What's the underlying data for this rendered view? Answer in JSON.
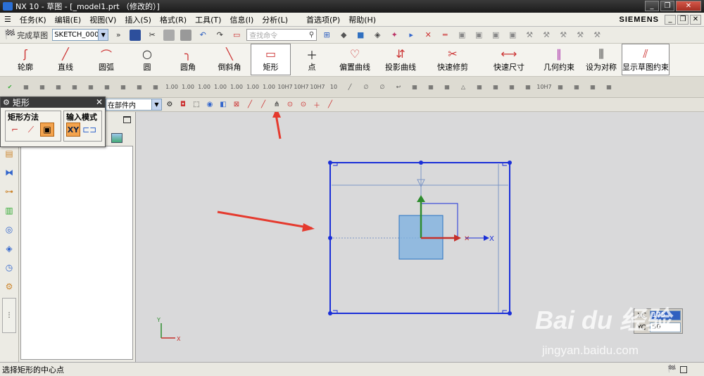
{
  "window": {
    "title": "NX 10 - 草图 - [_model1.prt （修改的）]",
    "brand": "SIEMENS",
    "min_label": "_",
    "restore_label": "❐",
    "close_label": "✕"
  },
  "menu": [
    "任务(K)",
    "编辑(E)",
    "视图(V)",
    "插入(S)",
    "格式(R)",
    "工具(T)",
    "信息(I)",
    "分析(L)",
    "首选项(P)",
    "帮助(H)"
  ],
  "toolbar": {
    "finish_sketch": "完成草图",
    "sketch_name": "SKETCH_000",
    "search_placeholder": "查找命令"
  },
  "ribbon": [
    {
      "label": "轮廓",
      "icon": "ʃ"
    },
    {
      "label": "直线",
      "icon": "╱"
    },
    {
      "label": "圆弧",
      "icon": "⌒"
    },
    {
      "label": "圆",
      "icon": "○"
    },
    {
      "label": "圆角",
      "icon": "╮"
    },
    {
      "label": "倒斜角",
      "icon": "╲"
    },
    {
      "label": "矩形",
      "icon": "▭"
    },
    {
      "label": "点",
      "icon": "＋"
    },
    {
      "label": "偏置曲线",
      "icon": "♡"
    },
    {
      "label": "投影曲线",
      "icon": "⇵"
    },
    {
      "label": "快速修剪",
      "icon": "✂"
    },
    {
      "label": "快速尺寸",
      "icon": "⟷"
    },
    {
      "label": "几何约束",
      "icon": "∥"
    },
    {
      "label": "设为对称",
      "icon": "⫼"
    },
    {
      "label": "显示草图约束",
      "icon": "⫽"
    }
  ],
  "filter": {
    "value": "在部件内"
  },
  "rect_dialog": {
    "title": "矩形",
    "method_label": "矩形方法",
    "input_mode_label": "输入模式",
    "xy_label": "XY"
  },
  "coords": {
    "xc_label": "XC",
    "xc_value": "175",
    "yc_label": "YC",
    "yc_value": "50"
  },
  "status": {
    "message": "选择矩形的中心点"
  },
  "watermark": {
    "logo": "Bai du 经验",
    "url": "jingyan.baidu.com"
  },
  "colors": {
    "sketch_blue": "#1a2fd8",
    "annotation_red": "#e53a2e",
    "canvas_bg": "#d9d9da"
  }
}
